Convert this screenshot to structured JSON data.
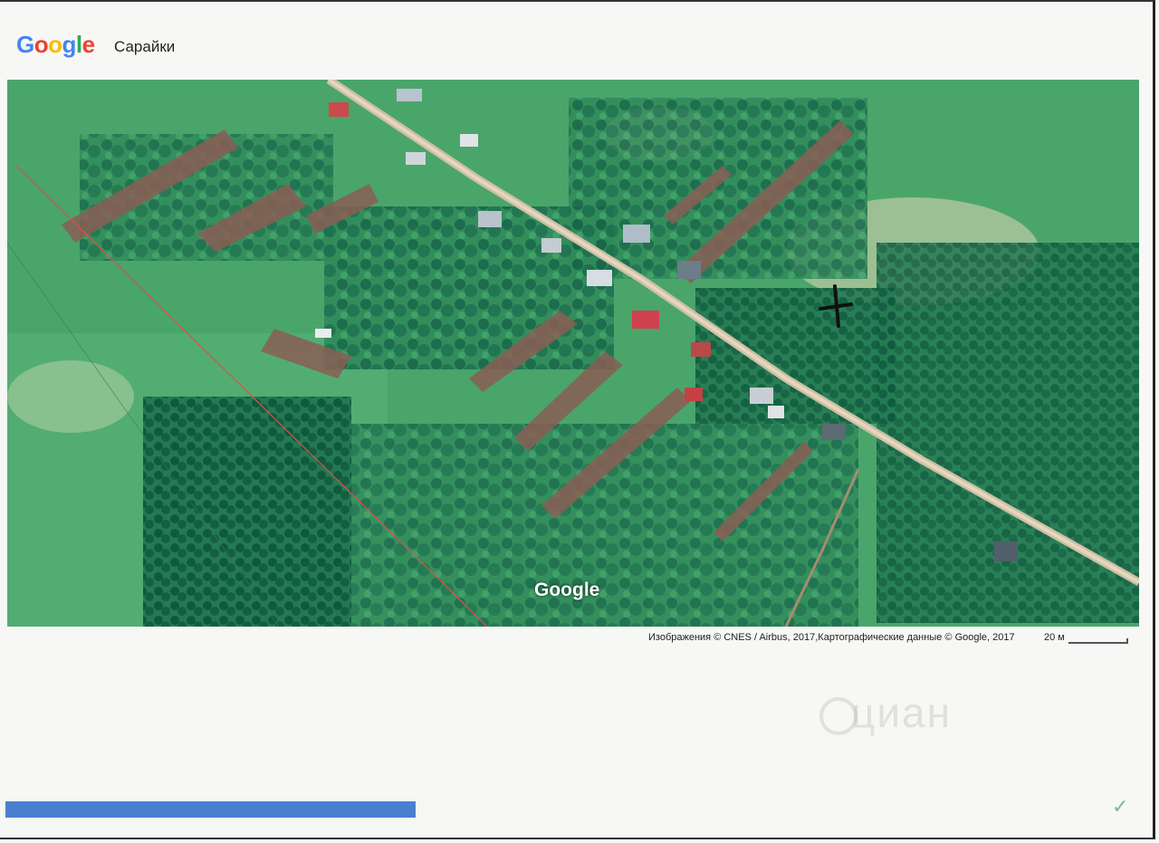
{
  "header": {
    "logo_letters": [
      "G",
      "o",
      "o",
      "g",
      "l",
      "e"
    ],
    "logo_colors": [
      "#4285F4",
      "#EA4335",
      "#FBBC05",
      "#4285F4",
      "#34A853",
      "#EA4335"
    ],
    "place_title": "Сарайки"
  },
  "map": {
    "type": "satellite",
    "watermark": "Google",
    "marker_symbol": "+",
    "attribution": "Изображения © CNES / Airbus, 2017,Картографические данные © Google, 2017",
    "scale_label": "20 м"
  },
  "page": {
    "bottom_bar_color": "#4a7fd0",
    "listing_watermark": "циан"
  }
}
